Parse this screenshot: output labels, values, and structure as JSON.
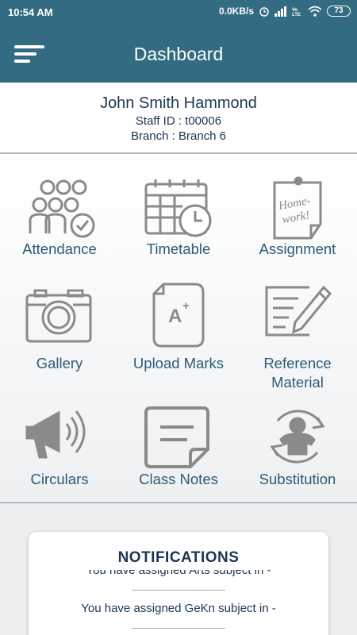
{
  "status_bar": {
    "time": "10:54 AM",
    "speed": "0.0KB/s",
    "battery": "73"
  },
  "app_bar": {
    "title": "Dashboard"
  },
  "profile": {
    "name": "John Smith Hammond",
    "staff_id": "Staff ID : t00006",
    "branch": "Branch : Branch 6"
  },
  "menu": [
    {
      "label": "Attendance",
      "icon": "attendance-icon"
    },
    {
      "label": "Timetable",
      "icon": "timetable-icon"
    },
    {
      "label": "Assignment",
      "icon": "assignment-icon"
    },
    {
      "label": "Gallery",
      "icon": "camera-icon"
    },
    {
      "label": "Upload Marks",
      "icon": "upload-marks-icon"
    },
    {
      "label": "Reference\nMaterial",
      "icon": "reference-material-icon"
    },
    {
      "label": "Circulars",
      "icon": "megaphone-icon"
    },
    {
      "label": "Class Notes",
      "icon": "notes-icon"
    },
    {
      "label": "Substitution",
      "icon": "substitution-icon"
    }
  ],
  "notifications": {
    "heading": "NOTIFICATIONS",
    "items": [
      "You have assigned Arts subject in  -",
      "You have assigned GeKn subject in  -"
    ]
  },
  "colors": {
    "app_bar": "#336b83",
    "text_primary": "#1b3553",
    "label": "#2d5a77",
    "icon_gray": "#8a8a8a"
  }
}
